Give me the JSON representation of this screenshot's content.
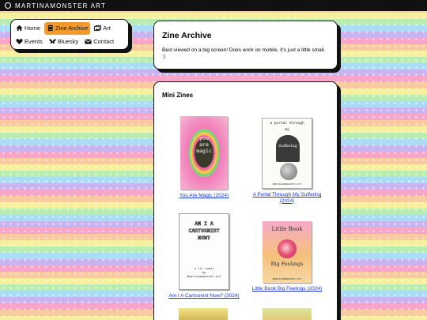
{
  "site": {
    "title": "MARTINAMONSTER ART"
  },
  "nav": {
    "items": [
      {
        "label": "Home",
        "icon": "home-icon",
        "active": false
      },
      {
        "label": "Zine Archive",
        "icon": "book-icon",
        "active": true
      },
      {
        "label": "Art",
        "icon": "images-icon",
        "active": false
      },
      {
        "label": "Events",
        "icon": "heart-icon",
        "active": false
      },
      {
        "label": "Bluesky",
        "icon": "butterfly-icon",
        "active": false
      },
      {
        "label": "Contact",
        "icon": "envelope-icon",
        "active": false
      }
    ]
  },
  "header": {
    "title": "Zine Archive",
    "note": "Best viewed on a big screen! Does work on mobile, it's just a little small. :)"
  },
  "section": {
    "title": "Mini Zines"
  },
  "zines": [
    {
      "title": "You Are Magic (2024)",
      "cover_text": [
        "you",
        "are",
        "magic"
      ]
    },
    {
      "title": "A Portal Through My Suffering (2024)",
      "cover_text": [
        "a portal through",
        "my",
        "Suffering",
        "@martinamonster.art"
      ]
    },
    {
      "title": "Am I A Cartoonist Now? (2024)",
      "cover_text": [
        "AM I A",
        "CARTOONIST",
        "NOW?",
        "a lil comic",
        "by",
        "@martinamonster.art"
      ]
    },
    {
      "title": "Little Book Big Feelings (2024)",
      "cover_text": [
        "Little Book",
        "Big Feelings",
        "@martinamonster.art"
      ]
    }
  ],
  "colors": {
    "active_nav": "#f39a2c",
    "link": "#1a36d6",
    "topbar": "#111111"
  }
}
